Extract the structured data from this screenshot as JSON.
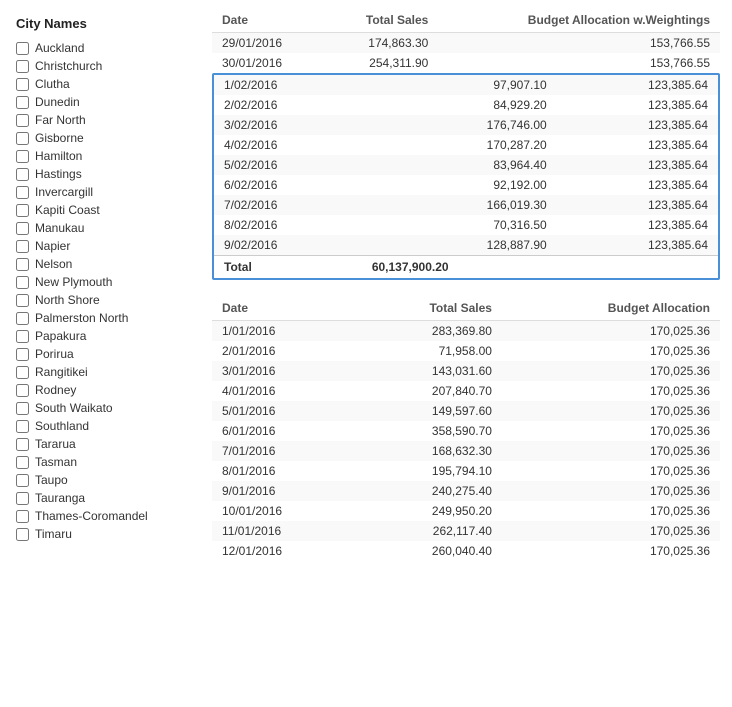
{
  "sidebar": {
    "title": "City Names",
    "items": [
      {
        "label": "Auckland",
        "checked": false
      },
      {
        "label": "Christchurch",
        "checked": false
      },
      {
        "label": "Clutha",
        "checked": false
      },
      {
        "label": "Dunedin",
        "checked": false
      },
      {
        "label": "Far North",
        "checked": false
      },
      {
        "label": "Gisborne",
        "checked": false
      },
      {
        "label": "Hamilton",
        "checked": false
      },
      {
        "label": "Hastings",
        "checked": false
      },
      {
        "label": "Invercargill",
        "checked": false
      },
      {
        "label": "Kapiti Coast",
        "checked": false
      },
      {
        "label": "Manukau",
        "checked": false
      },
      {
        "label": "Napier",
        "checked": false
      },
      {
        "label": "Nelson",
        "checked": false
      },
      {
        "label": "New Plymouth",
        "checked": false
      },
      {
        "label": "North Shore",
        "checked": false
      },
      {
        "label": "Palmerston North",
        "checked": false
      },
      {
        "label": "Papakura",
        "checked": false
      },
      {
        "label": "Porirua",
        "checked": false
      },
      {
        "label": "Rangitikei",
        "checked": false
      },
      {
        "label": "Rodney",
        "checked": false
      },
      {
        "label": "South Waikato",
        "checked": false
      },
      {
        "label": "Southland",
        "checked": false
      },
      {
        "label": "Tararua",
        "checked": false
      },
      {
        "label": "Tasman",
        "checked": false
      },
      {
        "label": "Taupo",
        "checked": false
      },
      {
        "label": "Tauranga",
        "checked": false
      },
      {
        "label": "Thames-Coromandel",
        "checked": false
      },
      {
        "label": "Timaru",
        "checked": false
      }
    ]
  },
  "table1": {
    "headers": [
      "Date",
      "Total Sales",
      "Budget Allocation w.Weightings"
    ],
    "partial_rows": [
      {
        "date": "29/01/2016",
        "sales": "174,863.30",
        "budget": "153,766.55"
      },
      {
        "date": "30/01/2016",
        "sales": "254,311.90",
        "budget": "153,766.55"
      }
    ],
    "rows": [
      {
        "date": "1/02/2016",
        "sales": "97,907.10",
        "budget": "123,385.64"
      },
      {
        "date": "2/02/2016",
        "sales": "84,929.20",
        "budget": "123,385.64"
      },
      {
        "date": "3/02/2016",
        "sales": "176,746.00",
        "budget": "123,385.64"
      },
      {
        "date": "4/02/2016",
        "sales": "170,287.20",
        "budget": "123,385.64"
      },
      {
        "date": "5/02/2016",
        "sales": "83,964.40",
        "budget": "123,385.64"
      },
      {
        "date": "6/02/2016",
        "sales": "92,192.00",
        "budget": "123,385.64"
      },
      {
        "date": "7/02/2016",
        "sales": "166,019.30",
        "budget": "123,385.64"
      },
      {
        "date": "8/02/2016",
        "sales": "70,316.50",
        "budget": "123,385.64"
      },
      {
        "date": "9/02/2016",
        "sales": "128,887.90",
        "budget": "123,385.64"
      }
    ],
    "total_label": "Total",
    "total_sales": "60,137,900.20",
    "total_budget": ""
  },
  "table2": {
    "headers": [
      "Date",
      "Total Sales",
      "Budget Allocation"
    ],
    "rows": [
      {
        "date": "1/01/2016",
        "sales": "283,369.80",
        "budget": "170,025.36"
      },
      {
        "date": "2/01/2016",
        "sales": "71,958.00",
        "budget": "170,025.36"
      },
      {
        "date": "3/01/2016",
        "sales": "143,031.60",
        "budget": "170,025.36"
      },
      {
        "date": "4/01/2016",
        "sales": "207,840.70",
        "budget": "170,025.36"
      },
      {
        "date": "5/01/2016",
        "sales": "149,597.60",
        "budget": "170,025.36"
      },
      {
        "date": "6/01/2016",
        "sales": "358,590.70",
        "budget": "170,025.36"
      },
      {
        "date": "7/01/2016",
        "sales": "168,632.30",
        "budget": "170,025.36"
      },
      {
        "date": "8/01/2016",
        "sales": "195,794.10",
        "budget": "170,025.36"
      },
      {
        "date": "9/01/2016",
        "sales": "240,275.40",
        "budget": "170,025.36"
      },
      {
        "date": "10/01/2016",
        "sales": "249,950.20",
        "budget": "170,025.36"
      },
      {
        "date": "11/01/2016",
        "sales": "262,117.40",
        "budget": "170,025.36"
      },
      {
        "date": "12/01/2016",
        "sales": "260,040.40",
        "budget": "170,025.36"
      }
    ]
  }
}
